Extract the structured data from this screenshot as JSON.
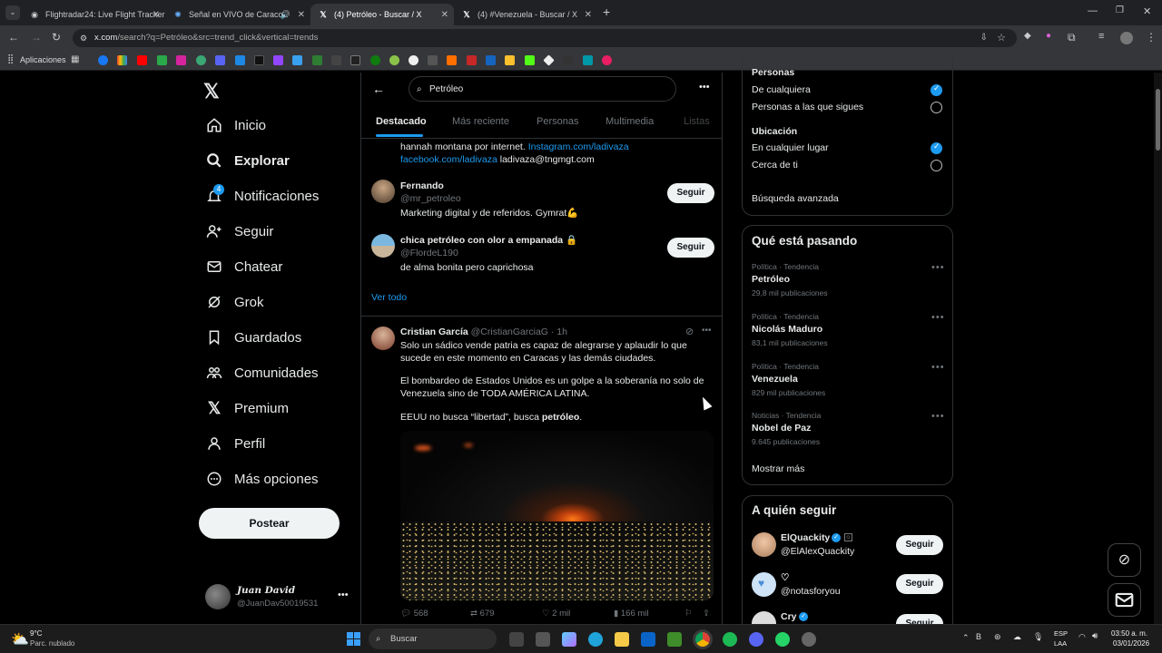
{
  "browser": {
    "tabs": [
      {
        "title": "Flightradar24: Live Flight Tracker",
        "active": false
      },
      {
        "title": "Señal en VIVO de Caracol Televisión",
        "active": false
      },
      {
        "title": "(4) Petróleo - Buscar / X",
        "active": true
      },
      {
        "title": "(4) #Venezuela - Buscar / X",
        "active": false
      }
    ],
    "url_host": "x.com",
    "url_path": "/search?q=Petróleo&src=trend_click&vertical=trends",
    "bookmarks_label": "Aplicaciones"
  },
  "nav": {
    "items": [
      {
        "label": "Inicio",
        "icon": "home-icon"
      },
      {
        "label": "Explorar",
        "icon": "search-icon"
      },
      {
        "label": "Notificaciones",
        "icon": "bell-icon",
        "badge": "4"
      },
      {
        "label": "Seguir",
        "icon": "person-add-icon"
      },
      {
        "label": "Chatear",
        "icon": "mail-icon"
      },
      {
        "label": "Grok",
        "icon": "grok-icon"
      },
      {
        "label": "Guardados",
        "icon": "bookmark-icon"
      },
      {
        "label": "Comunidades",
        "icon": "communities-icon"
      },
      {
        "label": "Premium",
        "icon": "x-logo-icon"
      },
      {
        "label": "Perfil",
        "icon": "profile-icon"
      },
      {
        "label": "Más opciones",
        "icon": "more-icon"
      }
    ],
    "post_label": "Postear",
    "user": {
      "name": "Juan David",
      "handle": "@JuanDav50019531"
    }
  },
  "search": {
    "query": "Petróleo",
    "tabs": [
      "Destacado",
      "Más reciente",
      "Personas",
      "Multimedia",
      "Listas"
    ]
  },
  "people": {
    "partial_bio_line1": "hannah montana por internet. ",
    "partial_bio_link1": "Instagram.com/ladivaza",
    "partial_bio_link2": "facebook.com/ladivaza",
    "partial_bio_rest": " ladivaza@tngmgt.com",
    "users": [
      {
        "name": "Fernando",
        "handle": "@mr_petroleo",
        "bio": "Marketing digital y de referidos. Gymrat💪",
        "follow": "Seguir"
      },
      {
        "name": "chica petróleo con olor a empanada 🔒",
        "handle": "@FlordeL190",
        "bio": "de alma bonita pero caprichosa",
        "follow": "Seguir"
      }
    ],
    "see_all": "Ver todo"
  },
  "tweet": {
    "name": "Cristian García",
    "handle": "@CristianGarciaG",
    "time": "· 1h",
    "p1": "Solo un sádico vende patria es capaz de alegrarse  y aplaudir lo que sucede en este momento en Caracas y las demás ciudades.",
    "p2": "El bombardeo de Estados Unidos es un golpe a la soberanía no solo de Venezuela sino de TODA AMÉRICA LATINA.",
    "p3_start": "EEUU no busca “libertad”, busca ",
    "p3_bold": "petróleo",
    "p3_end": ".",
    "replies": "568",
    "reposts": "679",
    "likes": "2 mil",
    "views": "166 mil"
  },
  "filters": {
    "people_heading": "Personas",
    "people_options": [
      "De cualquiera",
      "Personas a las que sigues"
    ],
    "people_selected": 0,
    "location_heading": "Ubicación",
    "location_options": [
      "En cualquier lugar",
      "Cerca de ti"
    ],
    "location_selected": 0,
    "advanced": "Búsqueda avanzada"
  },
  "trends": {
    "heading": "Qué está pasando",
    "items": [
      {
        "category": "Política · Tendencia",
        "name": "Petróleo",
        "count": "29,8 mil publicaciones"
      },
      {
        "category": "Política · Tendencia",
        "name": "Nicolás Maduro",
        "count": "83,1 mil publicaciones"
      },
      {
        "category": "Política · Tendencia",
        "name": "Venezuela",
        "count": "829 mil publicaciones"
      },
      {
        "category": "Noticias · Tendencia",
        "name": "Nobel de Paz",
        "count": "9.645 publicaciones"
      }
    ],
    "show_more": "Mostrar más"
  },
  "who_to_follow": {
    "heading": "A quién seguir",
    "users": [
      {
        "name": "ElQuackity",
        "handle": "@ElAlexQuackity",
        "follow": "Seguir"
      },
      {
        "name": "♡",
        "handle": "@notasforyou",
        "follow": "Seguir"
      },
      {
        "name": "Cry",
        "handle": "",
        "follow": "Seguir"
      }
    ]
  },
  "taskbar": {
    "temp": "9°C",
    "weather": "Parc. nublado",
    "search": "Buscar",
    "lang": "ESP",
    "lang2": "LAA",
    "time": "03:50 a. m.",
    "date": "03/01/2026"
  },
  "colors": {
    "accent": "#1d9bf0",
    "bg": "#000000",
    "text": "#e7e9ea",
    "muted": "#71767b"
  }
}
